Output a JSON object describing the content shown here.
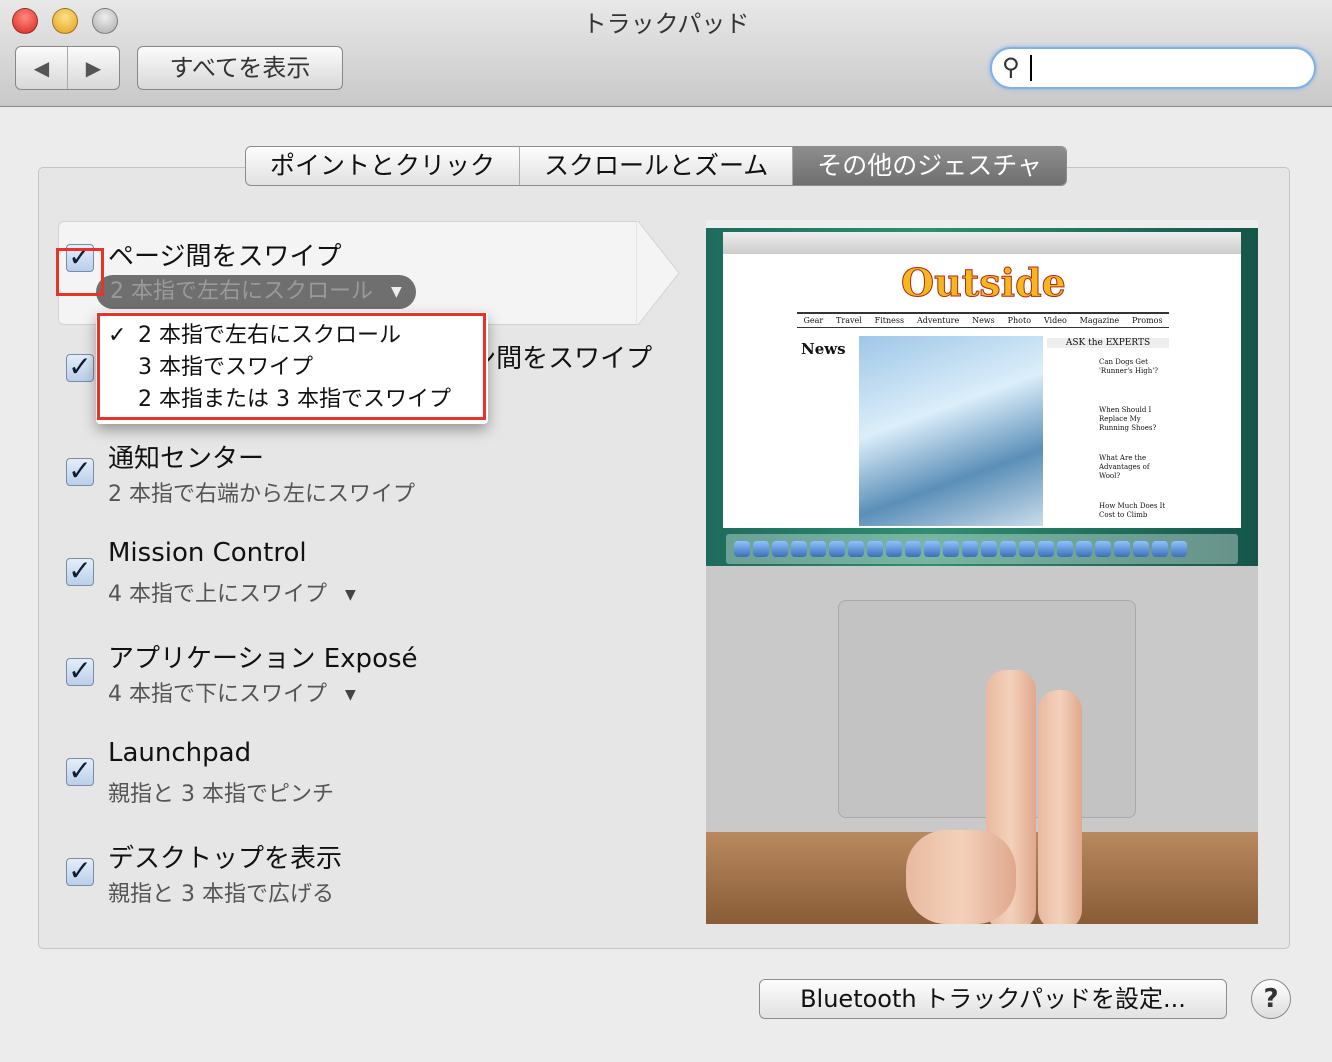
{
  "window": {
    "title": "トラックパッド"
  },
  "toolbar": {
    "back": "◀",
    "forward": "▶",
    "show_all": "すべてを表示",
    "search_icon": "⚲",
    "search_value": ""
  },
  "tabs": [
    {
      "label": "ポイントとクリック"
    },
    {
      "label": "スクロールとズーム"
    },
    {
      "label": "その他のジェスチャ",
      "selected": true
    }
  ],
  "gestures": [
    {
      "title": "ページ間をスワイプ",
      "checked": true,
      "popup_value": "2 本指で左右にスクロール"
    },
    {
      "title": "フルスクリーンアプリケーション間をスワイプ",
      "checked": true
    },
    {
      "title": "通知センター",
      "subtitle": "2 本指で右端から左にスワイプ",
      "checked": true
    },
    {
      "title": "Mission Control",
      "subtitle": "4 本指で上にスワイプ",
      "checked": true,
      "has_menu": true
    },
    {
      "title": "アプリケーション Exposé",
      "subtitle": "4 本指で下にスワイプ",
      "checked": true,
      "has_menu": true
    },
    {
      "title": "Launchpad",
      "subtitle": "親指と 3 本指でピンチ",
      "checked": true
    },
    {
      "title": "デスクトップを表示",
      "subtitle": "親指と 3 本指で広げる",
      "checked": true
    }
  ],
  "popup_menu": {
    "items": [
      {
        "label": "2 本指で左右にスクロール",
        "checked": true
      },
      {
        "label": "3 本指でスワイプ"
      },
      {
        "label": "2 本指または 3 本指でスワイプ"
      }
    ],
    "check": "✓"
  },
  "preview": {
    "site_logo": "Outside",
    "nav": [
      "Gear",
      "Travel",
      "Fitness",
      "Adventure",
      "News",
      "Photo",
      "Video",
      "Magazine",
      "Promos"
    ],
    "news": "News",
    "ask": "ASK the EXPERTS",
    "q": [
      "Can Dogs Get 'Runner's High'?",
      "When Should I Replace My Running Shoes?",
      "What Are the Advantages of Wool?",
      "How Much Does It Cost to Climb"
    ]
  },
  "footer": {
    "bluetooth_button": "Bluetooth トラックパッドを設定...",
    "help": "?"
  },
  "colors": {
    "highlight": "#e8332a",
    "selected_tab": "#7a7a7a"
  }
}
